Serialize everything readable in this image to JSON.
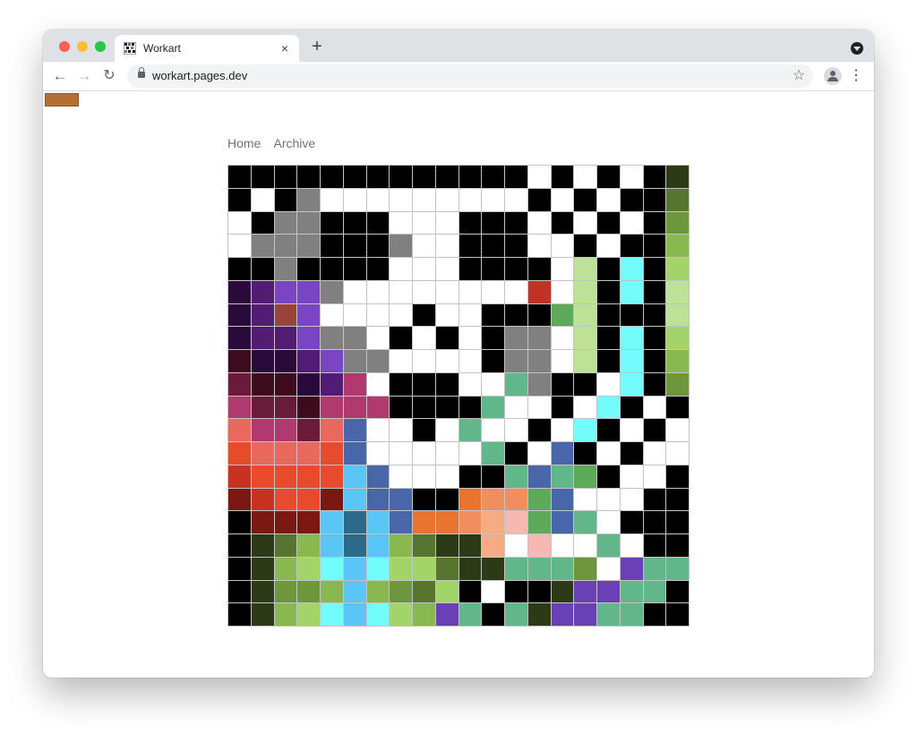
{
  "browser": {
    "tab": {
      "title": "Workart",
      "close_glyph": "×"
    },
    "new_tab_glyph": "+",
    "url": "workart.pages.dev",
    "icons": {
      "back": "←",
      "forward": "→",
      "reload": "↻",
      "star": "☆",
      "menu": "⋮"
    }
  },
  "page": {
    "swatch_color": "#b56f34",
    "nav": [
      {
        "label": "Home"
      },
      {
        "label": "Archive"
      }
    ],
    "palette": {
      "K": "#000000",
      "W": "#ffffff",
      "G": "#808080",
      "1": "#2d3a16",
      "2": "#56752f",
      "3": "#6e963c",
      "4": "#88b84f",
      "5": "#a3d46a",
      "6": "#bde296",
      "C": "#72fcfc",
      "R": "#c33125",
      "m": "#5daa5b",
      "a": "#62b78a",
      "o": "#e9742f",
      "p": "#f08e5e",
      "q": "#f6ab83",
      "r": "#f5b8b2",
      "L": "#5bc5f7",
      "D": "#2b6a8a",
      "b": "#4a66aa",
      "v": "#6a40b7",
      "u": "#2a0a3a",
      "w": "#521c74",
      "x": "#7a45c2",
      "t": "#9a433c",
      "e": "#3d0a1e",
      "y": "#6a1b3a",
      "z": "#b03a70",
      "n": "#e9685e",
      "f": "#e84a2c",
      "g": "#c83321",
      "h": "#7a1812"
    },
    "art_rows": [
      "KKKKKKKKKKKKKWKWKWK1",
      "KWKGWWWWWWWWWKWKWKK2",
      "WKGGKKKWWWKKKWKWKWK3",
      "WGGGKKKGWWKKKWWKWKK4",
      "KKGKKKKWWWKKKKW6KCK5",
      "uwxxGWWWWWWWWRW6KCK6",
      "uwtxWWWWKWWKKKm6KKK6",
      "uwwxGGWKWKWKGGW6KCK5",
      "euuwxGGWWWWKGGW6KCK4",
      "yeeuwzWKKKWWaGKKWCK3",
      "zyyezzzKKKKaWWKWCKWK",
      "nzzynbWWKWaWWKWCKWKW",
      "fnnnfbWWWWWaKWbKWKWW",
      "gffffLbWWWKKaba mKWWK",
      "hgffhLbbKKoppmbWWWKK",
      "KhhhLDLboopqrmbaWKKK",
      "K124LDL4211qWrWWaWKK",
      "K145CLC55211aaa3WvaaKK",
      "K1334L4325KWKK1vvaaKK",
      "K145CLC54vaKa1vvaaKK"
    ]
  }
}
